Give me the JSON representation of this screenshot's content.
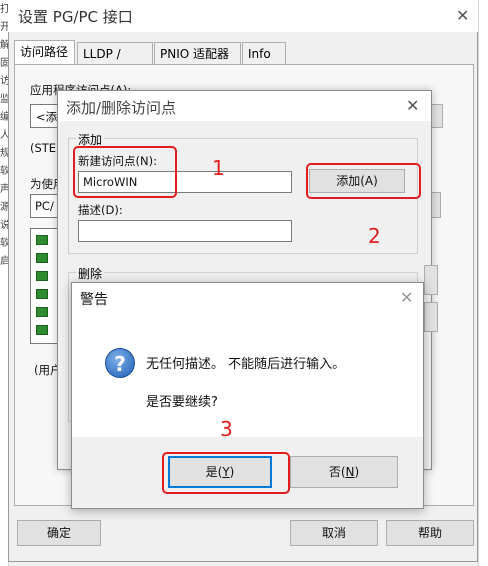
{
  "main_window": {
    "title": "设置 PG/PC 接口",
    "tabs": [
      "访问路径",
      "LLDP / DCP",
      "PNIO 适配器",
      "Info"
    ],
    "app_access_label": "应用程序访问点(A):",
    "access_value_fragment": "<添",
    "step_fragment": "(STE",
    "for_use_fragment": "为使用",
    "pc_fragment": "PC/",
    "user_fragment": "(用户",
    "ok_label": "确定",
    "cancel_label": "取消",
    "help_label": "帮助"
  },
  "add_delete_dialog": {
    "title": "添加/删除访问点",
    "add_group": "添加",
    "new_access_point_label": "新建访问点(N):",
    "new_access_point_value": "MicroWIN",
    "add_button": "添加(A)",
    "description_label": "描述(D):",
    "description_value": "",
    "delete_group": "删除"
  },
  "warning_dialog": {
    "title": "警告",
    "message": "无任何描述。 不能随后进行输入。",
    "question": "是否要继续?",
    "yes_label": "是(",
    "yes_key": "Y",
    "yes_end": ")",
    "no_label": "否(",
    "no_key": "N",
    "no_end": ")"
  },
  "annotations": {
    "step1": "1",
    "step2": "2",
    "step3": "3",
    "color": "#e01e1e"
  },
  "icons": {
    "close": "✕",
    "question": "?"
  },
  "left_strip_chars": [
    "打",
    "开",
    "解",
    "固",
    "访",
    "监",
    "编",
    "人",
    "规",
    "软",
    "声",
    "源",
    "说",
    "软",
    "启"
  ]
}
